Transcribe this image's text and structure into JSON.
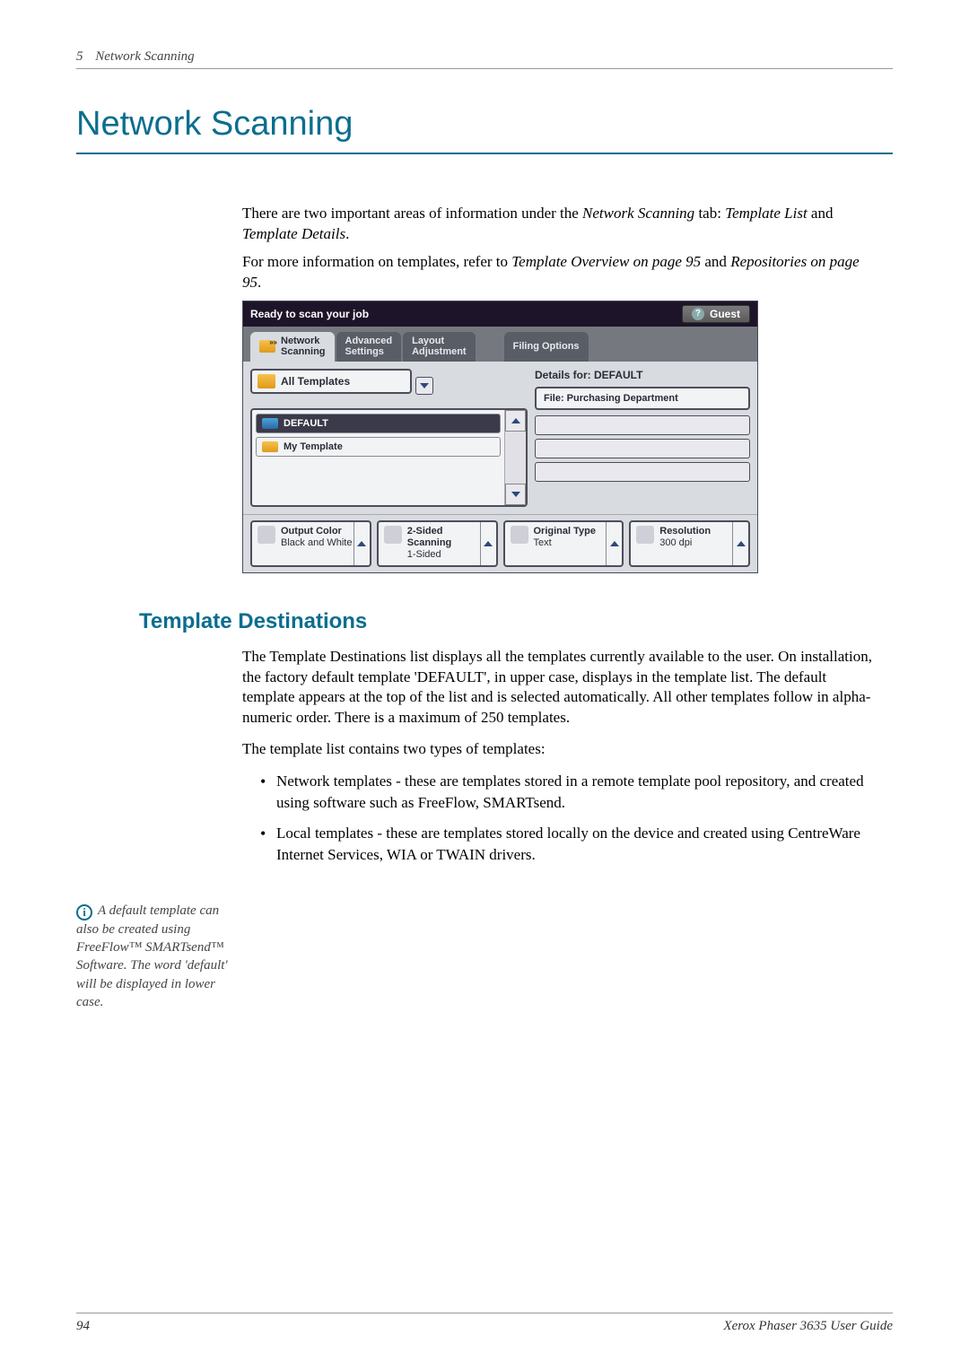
{
  "header": {
    "chapter_number": "5",
    "chapter_title": "Network Scanning"
  },
  "title": "Network Scanning",
  "intro": {
    "p1_a": "There are two important areas of information under the ",
    "p1_i1": "Network Scanning",
    "p1_b": " tab: ",
    "p1_i2": "Template List",
    "p1_c": " and ",
    "p1_i3": "Template Details",
    "p1_d": ".",
    "p2_a": "For more information on templates, refer to ",
    "p2_i1": "Template Overview on page 95",
    "p2_b": " and ",
    "p2_i2": "Repositories on page 95",
    "p2_c": "."
  },
  "screenshot": {
    "status": "Ready to scan your job",
    "guest": "Guest",
    "tabs": {
      "network_l1": "Network",
      "network_l2": "Scanning",
      "advanced_l1": "Advanced",
      "advanced_l2": "Settings",
      "layout_l1": "Layout",
      "layout_l2": "Adjustment",
      "filing": "Filing Options"
    },
    "all_templates": "All Templates",
    "templates": {
      "t1": "DEFAULT",
      "t2": "My Template"
    },
    "details_for": "Details for: DEFAULT",
    "details_file": "File: Purchasing Department",
    "options": {
      "output_color_t": "Output Color",
      "output_color_v": "Black and White",
      "two_sided_t1": "2-Sided",
      "two_sided_t2": "Scanning",
      "two_sided_v": "1-Sided",
      "original_type_t": "Original Type",
      "original_type_v": "Text",
      "resolution_t": "Resolution",
      "resolution_v": "300 dpi"
    }
  },
  "section": {
    "title": "Template Destinations",
    "p1": "The Template Destinations list displays all the templates currently available to the user. On installation, the factory default template 'DEFAULT', in upper case, displays in the template list. The default template appears at the top of the list and is selected automatically. All other templates follow in alpha-numeric order. There is a maximum of 250 templates.",
    "p2": "The template list contains two types of templates:",
    "b1": "Network templates - these are templates stored in a remote template pool repository, and created using software such as FreeFlow, SMARTsend.",
    "b2": "Local templates - these are templates stored locally on the device and created using CentreWare Internet Services, WIA or TWAIN drivers."
  },
  "margin_note": {
    "text": "A default template can also be created using FreeFlow™ SMARTsend™ Software. The word 'default' will be displayed in lower case."
  },
  "footer": {
    "page": "94",
    "book": "Xerox Phaser 3635 User Guide"
  }
}
